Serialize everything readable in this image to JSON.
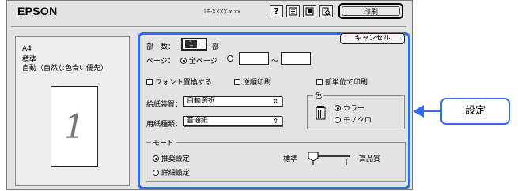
{
  "header": {
    "logo": "EPSON",
    "model": "LP-XXXX  x.xx",
    "icons": [
      "help-icon",
      "printer-settings-icon",
      "layout-icon",
      "preview-icon"
    ],
    "print_label": "印刷"
  },
  "left_panel": {
    "paper_size": "A4",
    "mode": "標準",
    "color": "自動（自然な色合い優先）",
    "preview_number": "1"
  },
  "settings": {
    "copies_label": "部　数：",
    "copies_value": "1",
    "copies_unit": "部",
    "pages_label": "ページ：",
    "pages_all": "全ページ",
    "pages_from": "",
    "pages_tilde": "～",
    "pages_to": "",
    "font_replace": "フォント置換する",
    "reverse": "逆順印刷",
    "collate": "部単位で印刷",
    "source_label": "給紙装置：",
    "source_value": "自動選択",
    "paper_type_label": "用紙種類：",
    "paper_type_value": "普通紙",
    "color_group": "色",
    "color_option": "カラー",
    "mono_option": "モノクロ",
    "mode_group": "モード",
    "mode_recommended": "推奨設定",
    "mode_detail": "詳細設定",
    "quality_left": "標準",
    "quality_right": "高品質",
    "cancel_label": "キャンセル"
  },
  "callout": {
    "label": "設定",
    "color": "#2f6cf0"
  }
}
